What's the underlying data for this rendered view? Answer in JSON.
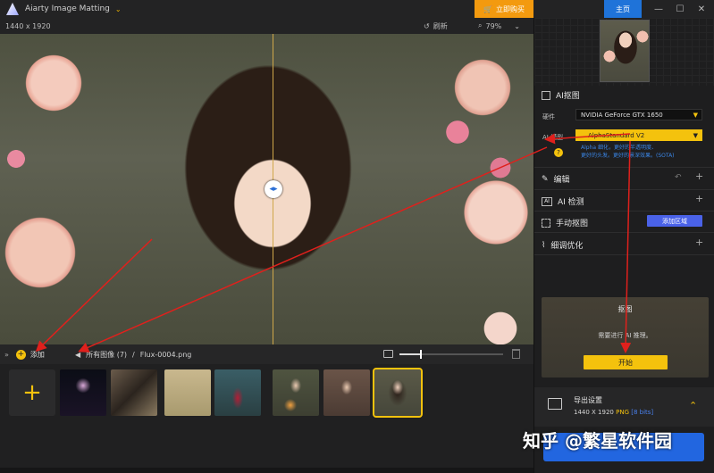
{
  "titlebar": {
    "app_title": "Aiarty Image Matting",
    "buy_label": "立即购买",
    "home_label": "主页"
  },
  "toolbar": {
    "dimensions": "1440 x 1920",
    "refresh_label": "刷新",
    "zoom_value": "79%"
  },
  "strip": {
    "add_label": "添加",
    "breadcrumb_all": "所有图像 (7)",
    "breadcrumb_sep": "/",
    "breadcrumb_file": "Flux-0004.png",
    "thumb_size_level": 0.2
  },
  "panel": {
    "ai_matting_title": "AI抠图",
    "hardware_label": "硬件",
    "hardware_value": "NVIDIA GeForce GTX 1650",
    "model_label": "AI 模型",
    "model_value": "AlphaStandard  V2",
    "model_desc_1": "Alpha 细化，更好的半透明度、",
    "model_desc_2": "更好的头发。更好的景深效果。(SOTA)",
    "edit_label": "编辑",
    "detect_label": "AI 检测",
    "manual_label": "手动抠图",
    "add_region_label": "添加区域",
    "refine_label": "细调优化",
    "matte_title": "抠图",
    "matte_note": "需要进行 AI 推理。",
    "start_label": "开始",
    "export_title": "导出设置",
    "export_dims": "1440 X 1920",
    "export_format": "PNG",
    "export_bits": "[8 bits]"
  },
  "watermark": "知乎 @繁星软件园",
  "colors": {
    "accent_yellow": "#f4c20d",
    "buy_orange": "#f39a0f",
    "home_blue": "#1f73d9",
    "arrow_red": "#e0201c"
  }
}
